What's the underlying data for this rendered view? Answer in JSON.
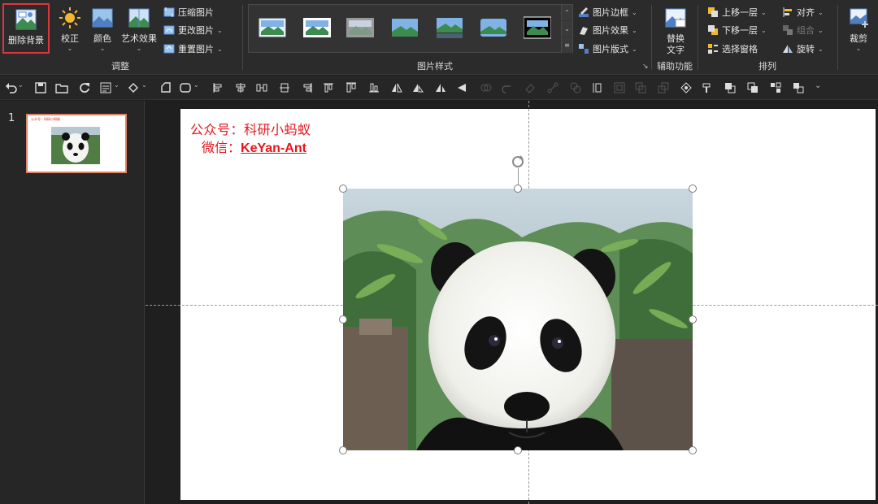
{
  "ribbon": {
    "adjust": {
      "group_label": "调整",
      "remove_background": "删除背景",
      "corrections": "校正",
      "color": "颜色",
      "artistic_effects": "艺术效果",
      "compress": "压缩图片",
      "change_picture": "更改图片",
      "reset_picture": "重置图片"
    },
    "picture_styles": {
      "group_label": "图片样式",
      "border": "图片边框",
      "effects": "图片效果",
      "layout": "图片版式"
    },
    "accessibility": {
      "group_label": "辅助功能",
      "alt_text_line1": "替换",
      "alt_text_line2": "文字"
    },
    "arrange": {
      "group_label": "排列",
      "bring_forward": "上移一层",
      "send_backward": "下移一层",
      "selection_pane": "选择窗格",
      "align": "对齐",
      "group": "组合",
      "rotate": "旋转"
    },
    "size": {
      "crop": "裁剪"
    }
  },
  "slides": {
    "number": "1"
  },
  "slide": {
    "watermark_line1": "公众号：科研小蚂蚁",
    "watermark_line2_prefix": "微信：",
    "watermark_line2_id": "KeYan-Ant"
  },
  "colors": {
    "accent_red": "#e8141c",
    "selection_border": "#d9363e",
    "thumb_border": "#e08264"
  }
}
